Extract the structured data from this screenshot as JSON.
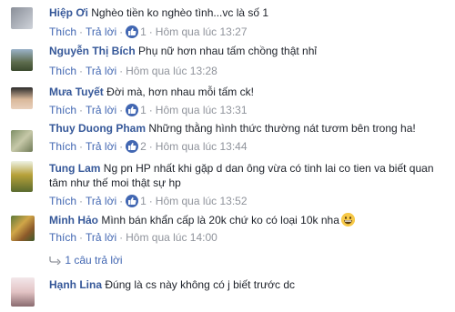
{
  "actions": {
    "like": "Thích",
    "reply": "Trả lời",
    "like_count": "1",
    "like_count_2": "2"
  },
  "comments": [
    {
      "author": "Hiệp Ơi",
      "text": "Nghèo tiền ko nghèo tình...vc là số 1",
      "likes": "1",
      "time": "Hôm qua lúc 13:27"
    },
    {
      "author": "Nguyễn Thị Bích",
      "text": "Phụ nữ hơn nhau tấm chồng thật nhỉ",
      "time": "Hôm qua lúc 13:28"
    },
    {
      "author": "Mưa Tuyết",
      "text": "Đời mà, hơn nhau mỗi tấm ck!",
      "likes": "1",
      "time": "Hôm qua lúc 13:31"
    },
    {
      "author": "Thuy Duong Pham",
      "text": "Những thằng hình thức thường nát tươm bên trong ha!",
      "likes": "2",
      "time": "Hôm qua lúc 13:44"
    },
    {
      "author": "Tung Lam",
      "text": "Ng pn HP nhất khi gặp d dan ông vừa có tinh lai co tien va biết quan tâm như thế moi thật sự hp",
      "likes": "1",
      "time": "Hôm qua lúc 13:52"
    },
    {
      "author": "Minh Hảo",
      "text": "Mình bán khẩn cấp là 20k chứ ko có loại 10k nha",
      "time": "Hôm qua lúc 14:00"
    },
    {
      "author": "Hạnh Lina",
      "text": "Đúng là cs này không có j biết trước dc"
    }
  ],
  "replies_link": "1 câu trả lời",
  "colors": {
    "author": "#365899",
    "link": "#4267b2",
    "meta": "#90949c",
    "text": "#1d2129"
  }
}
